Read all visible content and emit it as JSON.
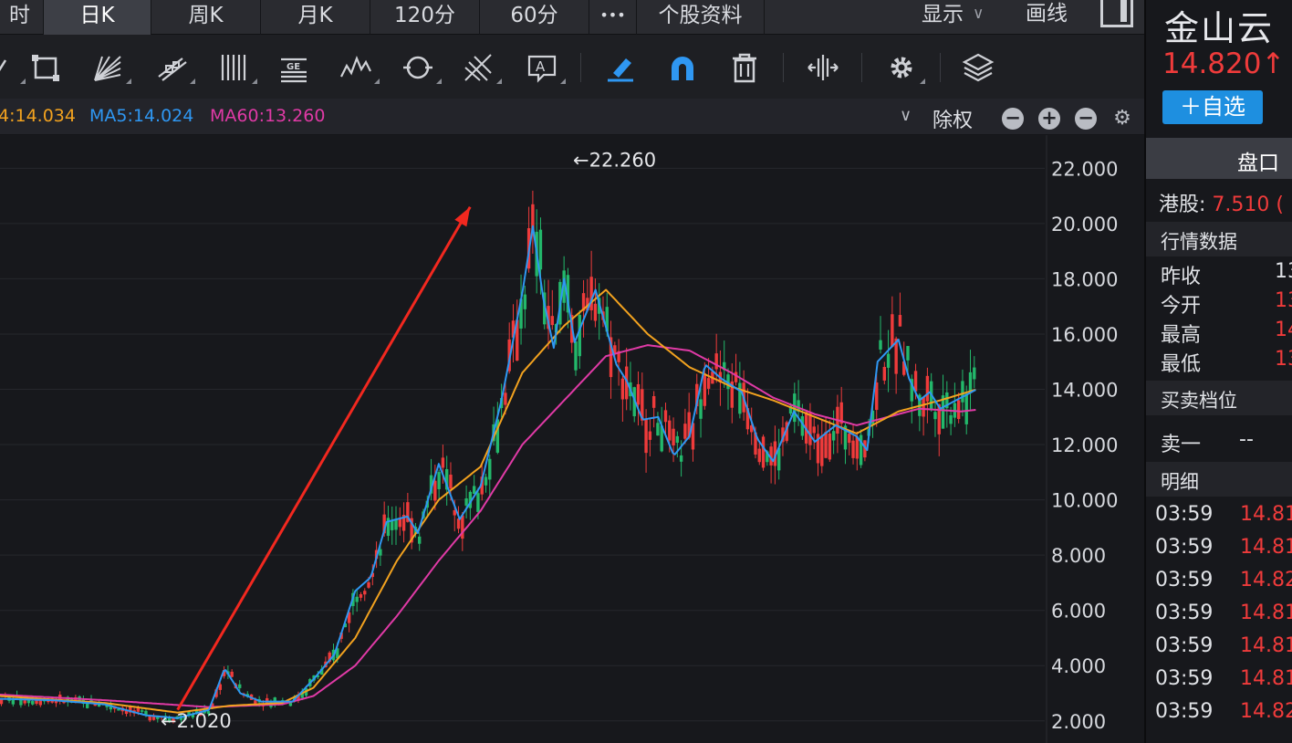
{
  "tabs": [
    {
      "label": "时",
      "active": false
    },
    {
      "label": "日K",
      "active": true
    },
    {
      "label": "周K",
      "active": false
    },
    {
      "label": "月K",
      "active": false
    },
    {
      "label": "120分",
      "active": false
    },
    {
      "label": "60分",
      "active": false
    },
    {
      "label": "•••",
      "active": false
    },
    {
      "label": "个股资料",
      "active": false
    }
  ],
  "toolbar_right": {
    "display_label": "显示",
    "draw_label": "画线"
  },
  "tools": [
    "rectangle-tool-icon",
    "fan-tool-icon",
    "channel-tool-icon",
    "vertical-lines-tool-icon",
    "gann-tool-icon",
    "wave-tool-icon",
    "cycle-tool-icon",
    "fork-tool-icon",
    "text-tool-icon",
    "highlight-pen-icon",
    "magnet-icon",
    "trash-icon",
    "split-view-icon",
    "settings-icon",
    "layers-icon"
  ],
  "ma_legend": [
    {
      "label": "4:14.034",
      "color": "#f2a21f"
    },
    {
      "label": "MA5:14.024",
      "color": "#2f97f2"
    },
    {
      "label": "MA60:13.260",
      "color": "#e03aa6"
    }
  ],
  "adjust_label": "除权",
  "colors": {
    "up": "#ef3b3b",
    "down": "#23b86b",
    "ma5": "#2f97f2",
    "ma20": "#f2a21f",
    "ma60": "#e03aa6",
    "accent": "#1e8fe0"
  },
  "chart_data": {
    "type": "candlestick",
    "y_ticks": [
      "22.000",
      "20.000",
      "18.000",
      "16.000",
      "14.000",
      "12.000",
      "10.000",
      "8.000",
      "6.000",
      "4.000",
      "2.000"
    ],
    "ylim": [
      1.2,
      23.2
    ],
    "annotations": {
      "high_label": "←22.260",
      "low_label": "←2.020",
      "high": 22.26,
      "low": 2.02
    },
    "trend_arrow": {
      "from": [
        0.17,
        2.4
      ],
      "to": [
        0.45,
        20.6
      ]
    },
    "ma5_path": [
      [
        0.0,
        2.8
      ],
      [
        0.05,
        2.75
      ],
      [
        0.1,
        2.6
      ],
      [
        0.14,
        2.2
      ],
      [
        0.17,
        2.1
      ],
      [
        0.2,
        2.4
      ],
      [
        0.215,
        3.9
      ],
      [
        0.23,
        3.0
      ],
      [
        0.25,
        2.7
      ],
      [
        0.28,
        2.7
      ],
      [
        0.3,
        3.5
      ],
      [
        0.32,
        4.4
      ],
      [
        0.34,
        6.7
      ],
      [
        0.355,
        7.2
      ],
      [
        0.37,
        9.2
      ],
      [
        0.39,
        9.4
      ],
      [
        0.4,
        8.8
      ],
      [
        0.42,
        11.3
      ],
      [
        0.44,
        9.3
      ],
      [
        0.46,
        10.5
      ],
      [
        0.48,
        13.6
      ],
      [
        0.5,
        17.5
      ],
      [
        0.51,
        19.9
      ],
      [
        0.52,
        17.3
      ],
      [
        0.53,
        15.5
      ],
      [
        0.54,
        18.0
      ],
      [
        0.55,
        15.7
      ],
      [
        0.57,
        17.6
      ],
      [
        0.59,
        14.9
      ],
      [
        0.6,
        14.3
      ],
      [
        0.615,
        12.9
      ],
      [
        0.63,
        13.0
      ],
      [
        0.645,
        11.6
      ],
      [
        0.66,
        12.3
      ],
      [
        0.675,
        14.9
      ],
      [
        0.69,
        14.4
      ],
      [
        0.71,
        13.9
      ],
      [
        0.725,
        12.2
      ],
      [
        0.74,
        11.4
      ],
      [
        0.76,
        13.2
      ],
      [
        0.78,
        12.1
      ],
      [
        0.8,
        12.7
      ],
      [
        0.82,
        12.3
      ],
      [
        0.83,
        11.8
      ],
      [
        0.84,
        15.0
      ],
      [
        0.86,
        15.8
      ],
      [
        0.87,
        14.4
      ],
      [
        0.88,
        13.6
      ],
      [
        0.89,
        13.9
      ],
      [
        0.9,
        13.3
      ],
      [
        0.92,
        13.7
      ],
      [
        0.935,
        14.0
      ]
    ],
    "ma20_path": [
      [
        0.0,
        2.9
      ],
      [
        0.1,
        2.65
      ],
      [
        0.17,
        2.3
      ],
      [
        0.22,
        2.55
      ],
      [
        0.27,
        2.65
      ],
      [
        0.3,
        3.2
      ],
      [
        0.34,
        5.0
      ],
      [
        0.38,
        7.8
      ],
      [
        0.42,
        10.0
      ],
      [
        0.46,
        11.2
      ],
      [
        0.5,
        14.6
      ],
      [
        0.54,
        16.3
      ],
      [
        0.58,
        17.6
      ],
      [
        0.62,
        16.0
      ],
      [
        0.66,
        14.8
      ],
      [
        0.7,
        14.1
      ],
      [
        0.74,
        13.6
      ],
      [
        0.78,
        13.0
      ],
      [
        0.82,
        12.4
      ],
      [
        0.86,
        13.2
      ],
      [
        0.9,
        13.6
      ],
      [
        0.935,
        14.0
      ]
    ],
    "ma60_path": [
      [
        0.0,
        2.95
      ],
      [
        0.1,
        2.75
      ],
      [
        0.2,
        2.5
      ],
      [
        0.27,
        2.6
      ],
      [
        0.3,
        2.9
      ],
      [
        0.34,
        4.0
      ],
      [
        0.38,
        5.8
      ],
      [
        0.42,
        7.8
      ],
      [
        0.46,
        9.6
      ],
      [
        0.5,
        12.0
      ],
      [
        0.54,
        13.6
      ],
      [
        0.58,
        15.2
      ],
      [
        0.62,
        15.6
      ],
      [
        0.66,
        15.4
      ],
      [
        0.7,
        14.6
      ],
      [
        0.74,
        13.7
      ],
      [
        0.78,
        13.1
      ],
      [
        0.82,
        12.7
      ],
      [
        0.84,
        12.9
      ],
      [
        0.88,
        13.3
      ],
      [
        0.92,
        13.2
      ],
      [
        0.935,
        13.26
      ]
    ],
    "candle_range": [
      0.0,
      0.935
    ]
  },
  "right": {
    "stock_name": "金山云",
    "price": "14.820↑",
    "watch_label": "＋自选",
    "quote_tab": "盘口",
    "hk_label": "港股:",
    "hk_value": "7.510 (",
    "section_market": "行情数据",
    "rows": [
      {
        "label": "昨收",
        "value": "13",
        "up": false
      },
      {
        "label": "今开",
        "value": "13",
        "up": true
      },
      {
        "label": "最高",
        "value": "14",
        "up": true
      },
      {
        "label": "最低",
        "value": "13",
        "up": true
      }
    ],
    "section_orders": "买卖档位",
    "sell1_label": "卖一",
    "sell1_value": "--",
    "section_ticks": "明细",
    "ticks": [
      {
        "time": "03:59",
        "price": "14.81"
      },
      {
        "time": "03:59",
        "price": "14.81"
      },
      {
        "time": "03:59",
        "price": "14.82"
      },
      {
        "time": "03:59",
        "price": "14.81"
      },
      {
        "time": "03:59",
        "price": "14.81"
      },
      {
        "time": "03:59",
        "price": "14.81"
      },
      {
        "time": "03:59",
        "price": "14.82"
      }
    ]
  }
}
